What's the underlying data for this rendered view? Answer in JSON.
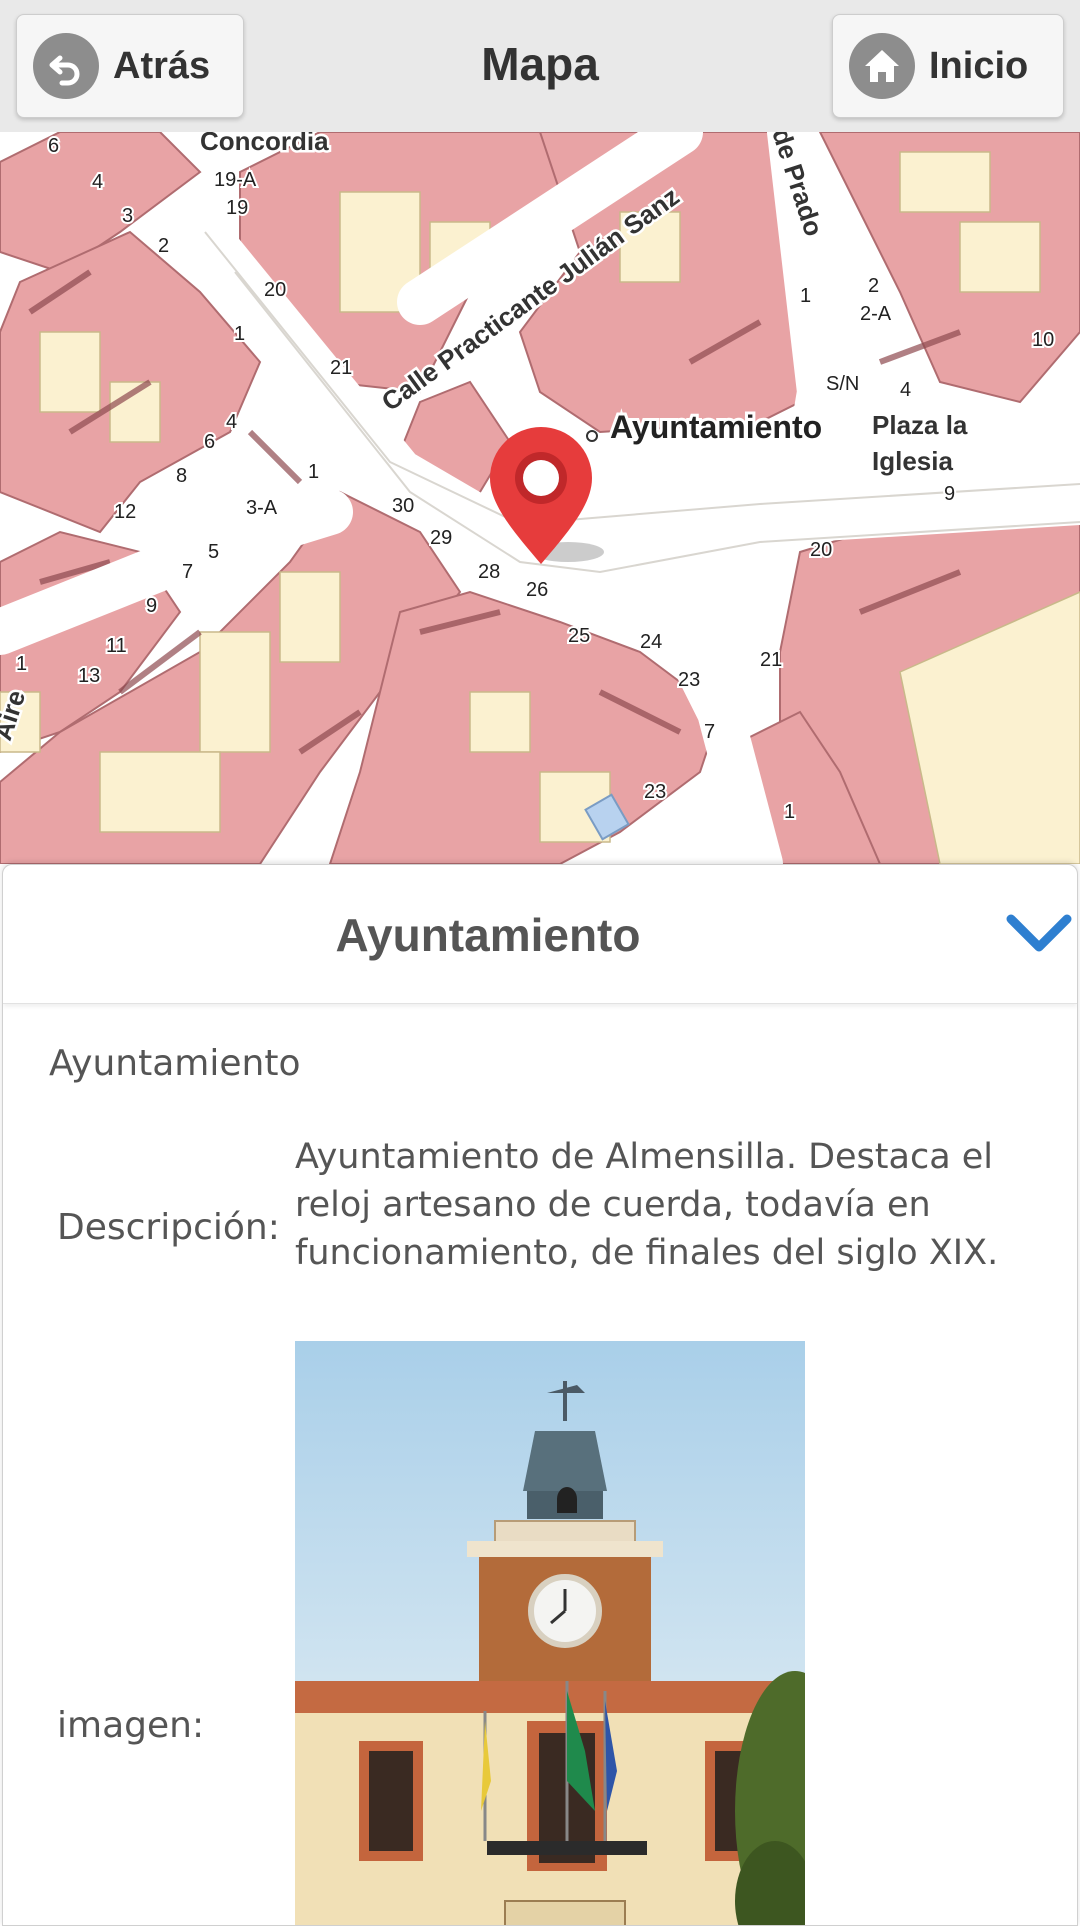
{
  "header": {
    "title": "Mapa",
    "back_label": "Atrás",
    "home_label": "Inicio"
  },
  "map": {
    "marker_label": "Ayuntamiento",
    "street_labels": [
      "Calle Practicante Julián Sanz",
      "Concordia",
      "Plaza la",
      "Iglesia",
      "de Prado",
      "Aire"
    ],
    "house_numbers": [
      "6",
      "4",
      "19-A",
      "19",
      "3",
      "2",
      "20",
      "1",
      "21",
      "4",
      "6",
      "8",
      "12",
      "3-A",
      "1",
      "30",
      "29",
      "28",
      "26",
      "25",
      "24",
      "23",
      "7",
      "23",
      "5",
      "7",
      "9",
      "11",
      "13",
      "1",
      "20",
      "21",
      "1",
      "S/N",
      "9",
      "10",
      "2",
      "2-A",
      "4",
      "1"
    ],
    "colors": {
      "building": "#e8a3a5",
      "building_edge": "#b06c70",
      "courtyard": "#fbf1d0",
      "street": "#ffffff",
      "marker": "#e63c3c"
    }
  },
  "panel": {
    "title": "Ayuntamiento",
    "name": "Ayuntamiento",
    "description_label": "Descripción:",
    "description": "Ayuntamiento de Almensilla. Destaca el reloj artesano de cuerda, todavía en funcionamiento, de finales del siglo XIX.",
    "image_label": "imagen:",
    "accent_color": "#2e7fd0"
  }
}
